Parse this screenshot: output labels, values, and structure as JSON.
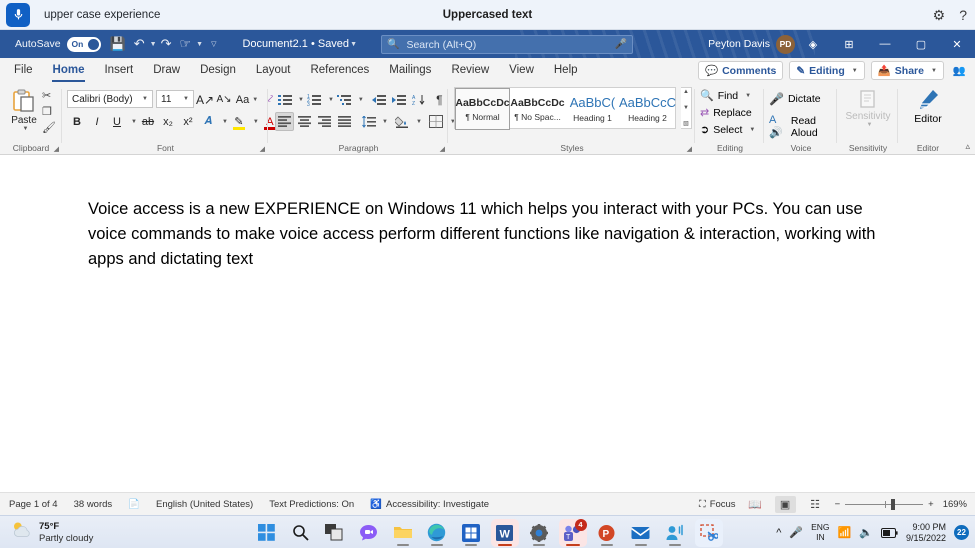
{
  "voice_access": {
    "mic_icon": "microphone-icon",
    "command_text": "upper case experience",
    "status_text": "Uppercased text",
    "settings_icon": "gear-icon",
    "help_icon": "help-icon"
  },
  "title_bar": {
    "autosave_label": "AutoSave",
    "autosave_state": "On",
    "save_icon": "save-icon",
    "undo_icon": "undo-icon",
    "redo_icon": "redo-icon",
    "touch_icon": "touch-mode-icon",
    "customize_icon": "customize-quick-access-icon",
    "document_name": "Document2.1 • Saved",
    "search_placeholder": "Search (Alt+Q)",
    "search_value": "",
    "search_icon": "search-icon",
    "search_mic_icon": "microphone-icon",
    "user_name": "Peyton Davis",
    "avatar_initials": "PD",
    "diamond_icon": "diamond-icon",
    "ribbon_display_icon": "ribbon-display-options-icon",
    "minimize": "—",
    "restore": "▢",
    "close": "✕",
    "accent_color": "#2b579a",
    "avatar_color": "#8c6239"
  },
  "tabs": [
    {
      "label": "File",
      "active": false
    },
    {
      "label": "Home",
      "active": true
    },
    {
      "label": "Insert",
      "active": false
    },
    {
      "label": "Draw",
      "active": false
    },
    {
      "label": "Design",
      "active": false
    },
    {
      "label": "Layout",
      "active": false
    },
    {
      "label": "References",
      "active": false
    },
    {
      "label": "Mailings",
      "active": false
    },
    {
      "label": "Review",
      "active": false
    },
    {
      "label": "View",
      "active": false
    },
    {
      "label": "Help",
      "active": false
    }
  ],
  "tab_actions": {
    "comments": "Comments",
    "editing": "Editing",
    "share": "Share",
    "comments_icon": "comment-bubble-icon",
    "editing_icon": "pencil-icon",
    "share_icon": "share-icon",
    "people_icon": "share-people-icon"
  },
  "ribbon": {
    "clipboard": {
      "group_label": "Clipboard",
      "paste_label": "Paste",
      "paste_icon": "paste-icon",
      "cut_icon": "scissors-icon",
      "copy_icon": "copy-icon",
      "format_painter_icon": "format-painter-icon"
    },
    "font": {
      "group_label": "Font",
      "font_family": "Calibri (Body)",
      "font_size": "11",
      "grow_font": "A",
      "shrink_font": "A",
      "change_case": "Aa",
      "clear_formatting_icon": "clear-formatting-icon",
      "bold": "B",
      "italic": "I",
      "underline": "U",
      "strikethrough_icon": "strikethrough-icon",
      "subscript": "x",
      "superscript": "x",
      "text_effects_icon": "text-effects-icon",
      "highlight_icon": "text-highlight-icon",
      "font_color_icon": "font-color-icon"
    },
    "paragraph": {
      "group_label": "Paragraph",
      "bullets_icon": "bullets-icon",
      "numbering_icon": "numbering-icon",
      "multilevel_icon": "multilevel-list-icon",
      "decrease_indent_icon": "decrease-indent-icon",
      "increase_indent_icon": "increase-indent-icon",
      "sort_icon": "sort-icon",
      "show_marks_icon": "show-formatting-marks-icon",
      "align_left_icon": "align-left-icon",
      "align_center_icon": "align-center-icon",
      "align_right_icon": "align-right-icon",
      "justify_icon": "justify-icon",
      "line_spacing_icon": "line-spacing-icon",
      "shading_icon": "shading-icon",
      "borders_icon": "borders-icon"
    },
    "styles": {
      "group_label": "Styles",
      "items": [
        {
          "preview": "AaBbCcDc",
          "name": "¶ Normal",
          "selected": true,
          "heading": false
        },
        {
          "preview": "AaBbCcDc",
          "name": "¶ No Spac...",
          "selected": false,
          "heading": false
        },
        {
          "preview": "AaBbC(",
          "name": "Heading 1",
          "selected": false,
          "heading": true
        },
        {
          "preview": "AaBbCcC",
          "name": "Heading 2",
          "selected": false,
          "heading": true
        }
      ]
    },
    "editing": {
      "group_label": "Editing",
      "find": "Find",
      "replace": "Replace",
      "select": "Select",
      "find_icon": "find-icon",
      "replace_icon": "replace-icon",
      "select_icon": "select-icon"
    },
    "voice": {
      "group_label": "Voice",
      "dictate": "Dictate",
      "read_aloud": "Read Aloud",
      "dictate_icon": "microphone-icon",
      "read_aloud_icon": "read-aloud-icon"
    },
    "sensitivity": {
      "group_label": "Sensitivity",
      "label": "Sensitivity",
      "icon": "sensitivity-icon",
      "disabled": true
    },
    "editor": {
      "group_label": "Editor",
      "label": "Editor",
      "icon": "editor-pen-icon"
    },
    "collapse_icon": "collapse-ribbon-icon"
  },
  "document": {
    "body_text": "Voice access is a new EXPERIENCE on Windows 11 which helps you interact with your PCs. You can use voice commands to make voice access perform different functions like navigation & interaction, working with apps and dictating text"
  },
  "status_bar": {
    "page": "Page 1 of 4",
    "words": "38 words",
    "proofing_icon": "proofing-errors-icon",
    "language": "English (United States)",
    "text_predictions": "Text Predictions: On",
    "accessibility_icon": "accessibility-icon",
    "accessibility": "Accessibility: Investigate",
    "focus": "Focus",
    "focus_icon": "focus-mode-icon",
    "read_mode_icon": "read-mode-icon",
    "print_layout_icon": "print-layout-icon",
    "web_layout_icon": "web-layout-icon",
    "zoom_out": "−",
    "zoom_in": "+",
    "zoom_level": "169%"
  },
  "taskbar": {
    "weather_temp": "75°F",
    "weather_desc": "Partly cloudy",
    "weather_icon": "partly-cloudy-icon",
    "apps": [
      {
        "name": "start-button",
        "icon": "windows-logo-icon",
        "active": false,
        "running": false,
        "badge": ""
      },
      {
        "name": "search-button",
        "icon": "search-icon",
        "active": false,
        "running": false,
        "badge": ""
      },
      {
        "name": "task-view-button",
        "icon": "task-view-icon",
        "active": false,
        "running": false,
        "badge": ""
      },
      {
        "name": "chat-button",
        "icon": "chat-icon",
        "active": false,
        "running": false,
        "badge": ""
      },
      {
        "name": "file-explorer-button",
        "icon": "file-explorer-icon",
        "active": false,
        "running": true,
        "badge": ""
      },
      {
        "name": "edge-button",
        "icon": "edge-icon",
        "active": false,
        "running": true,
        "badge": ""
      },
      {
        "name": "microsoft-store-button",
        "icon": "store-icon",
        "active": false,
        "running": true,
        "badge": ""
      },
      {
        "name": "word-button",
        "icon": "word-icon",
        "active": true,
        "running": true,
        "badge": ""
      },
      {
        "name": "settings-button",
        "icon": "settings-gear-icon",
        "active": false,
        "running": true,
        "badge": ""
      },
      {
        "name": "teams-button",
        "icon": "teams-icon",
        "active": false,
        "running": true,
        "badge": "4"
      },
      {
        "name": "powerpoint-button",
        "icon": "powerpoint-icon",
        "active": false,
        "running": true,
        "badge": ""
      },
      {
        "name": "mail-button",
        "icon": "mail-icon",
        "active": false,
        "running": true,
        "badge": ""
      },
      {
        "name": "voice-access-button",
        "icon": "voice-access-icon",
        "active": false,
        "running": true,
        "badge": ""
      },
      {
        "name": "snipping-tool-button",
        "icon": "snipping-tool-icon",
        "active": false,
        "running": false,
        "badge": ""
      }
    ],
    "tray": {
      "expand_icon": "show-hidden-icons-chevron",
      "mic_icon": "microphone-icon",
      "language_line1": "ENG",
      "language_line2": "IN",
      "wifi_icon": "wifi-icon",
      "volume_icon": "volume-icon",
      "battery_icon": "battery-icon",
      "time": "9:00 PM",
      "date": "9/15/2022",
      "notification_count": "22"
    }
  }
}
